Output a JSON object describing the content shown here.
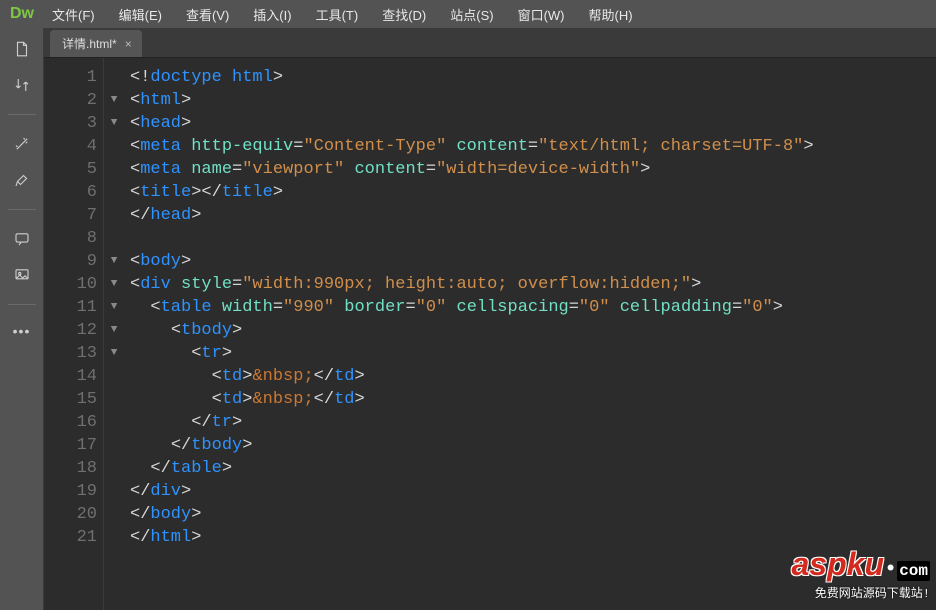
{
  "logo": "Dw",
  "menus": [
    "文件(F)",
    "编辑(E)",
    "查看(V)",
    "插入(I)",
    "工具(T)",
    "查找(D)",
    "站点(S)",
    "窗口(W)",
    "帮助(H)"
  ],
  "tab": {
    "title": "详情.html*",
    "close": "×"
  },
  "gutter_lines": 21,
  "fold_markers": {
    "2": "▼",
    "3": "▼",
    "9": "▼",
    "10": "▼",
    "11": "▼",
    "12": "▼",
    "13": "▼"
  },
  "code": [
    [
      [
        "pun",
        "<!"
      ],
      [
        "tag",
        "doctype html"
      ],
      [
        "pun",
        ">"
      ]
    ],
    [
      [
        "pun",
        "<"
      ],
      [
        "tag",
        "html"
      ],
      [
        "pun",
        ">"
      ]
    ],
    [
      [
        "pun",
        "<"
      ],
      [
        "tag",
        "head"
      ],
      [
        "pun",
        ">"
      ]
    ],
    [
      [
        "pun",
        "<"
      ],
      [
        "tag",
        "meta"
      ],
      [
        "txt",
        " "
      ],
      [
        "attr",
        "http-equiv"
      ],
      [
        "pun",
        "="
      ],
      [
        "str",
        "\"Content-Type\""
      ],
      [
        "txt",
        " "
      ],
      [
        "attr",
        "content"
      ],
      [
        "pun",
        "="
      ],
      [
        "str",
        "\"text/html; charset=UTF-8\""
      ],
      [
        "pun",
        ">"
      ]
    ],
    [
      [
        "pun",
        "<"
      ],
      [
        "tag",
        "meta"
      ],
      [
        "txt",
        " "
      ],
      [
        "attr",
        "name"
      ],
      [
        "pun",
        "="
      ],
      [
        "str",
        "\"viewport\""
      ],
      [
        "txt",
        " "
      ],
      [
        "attr",
        "content"
      ],
      [
        "pun",
        "="
      ],
      [
        "str",
        "\"width=device-width\""
      ],
      [
        "pun",
        ">"
      ]
    ],
    [
      [
        "pun",
        "<"
      ],
      [
        "tag",
        "title"
      ],
      [
        "pun",
        "></"
      ],
      [
        "tag",
        "title"
      ],
      [
        "pun",
        ">"
      ]
    ],
    [
      [
        "pun",
        "</"
      ],
      [
        "tag",
        "head"
      ],
      [
        "pun",
        ">"
      ]
    ],
    [],
    [
      [
        "pun",
        "<"
      ],
      [
        "tag",
        "body"
      ],
      [
        "pun",
        ">"
      ]
    ],
    [
      [
        "pun",
        "<"
      ],
      [
        "tag",
        "div"
      ],
      [
        "txt",
        " "
      ],
      [
        "attr",
        "style"
      ],
      [
        "pun",
        "="
      ],
      [
        "str",
        "\"width:990px; height:auto; overflow:hidden;\""
      ],
      [
        "pun",
        ">"
      ]
    ],
    [
      [
        "txt",
        "  "
      ],
      [
        "pun",
        "<"
      ],
      [
        "tag",
        "table"
      ],
      [
        "txt",
        " "
      ],
      [
        "attr",
        "width"
      ],
      [
        "pun",
        "="
      ],
      [
        "str",
        "\"990\""
      ],
      [
        "txt",
        " "
      ],
      [
        "attr",
        "border"
      ],
      [
        "pun",
        "="
      ],
      [
        "str",
        "\"0\""
      ],
      [
        "txt",
        " "
      ],
      [
        "attr",
        "cellspacing"
      ],
      [
        "pun",
        "="
      ],
      [
        "str",
        "\"0\""
      ],
      [
        "txt",
        " "
      ],
      [
        "attr",
        "cellpadding"
      ],
      [
        "pun",
        "="
      ],
      [
        "str",
        "\"0\""
      ],
      [
        "pun",
        ">"
      ]
    ],
    [
      [
        "txt",
        "    "
      ],
      [
        "pun",
        "<"
      ],
      [
        "tag",
        "tbody"
      ],
      [
        "pun",
        ">"
      ]
    ],
    [
      [
        "txt",
        "      "
      ],
      [
        "pun",
        "<"
      ],
      [
        "tag",
        "tr"
      ],
      [
        "pun",
        ">"
      ]
    ],
    [
      [
        "txt",
        "        "
      ],
      [
        "pun",
        "<"
      ],
      [
        "tag",
        "td"
      ],
      [
        "pun",
        ">"
      ],
      [
        "ent",
        "&nbsp;"
      ],
      [
        "pun",
        "</"
      ],
      [
        "tag",
        "td"
      ],
      [
        "pun",
        ">"
      ]
    ],
    [
      [
        "txt",
        "        "
      ],
      [
        "pun",
        "<"
      ],
      [
        "tag",
        "td"
      ],
      [
        "pun",
        ">"
      ],
      [
        "ent",
        "&nbsp;"
      ],
      [
        "pun",
        "</"
      ],
      [
        "tag",
        "td"
      ],
      [
        "pun",
        ">"
      ]
    ],
    [
      [
        "txt",
        "      "
      ],
      [
        "pun",
        "</"
      ],
      [
        "tag",
        "tr"
      ],
      [
        "pun",
        ">"
      ]
    ],
    [
      [
        "txt",
        "    "
      ],
      [
        "pun",
        "</"
      ],
      [
        "tag",
        "tbody"
      ],
      [
        "pun",
        ">"
      ]
    ],
    [
      [
        "txt",
        "  "
      ],
      [
        "pun",
        "</"
      ],
      [
        "tag",
        "table"
      ],
      [
        "pun",
        ">"
      ]
    ],
    [
      [
        "pun",
        "</"
      ],
      [
        "tag",
        "div"
      ],
      [
        "pun",
        ">"
      ]
    ],
    [
      [
        "pun",
        "</"
      ],
      [
        "tag",
        "body"
      ],
      [
        "pun",
        ">"
      ]
    ],
    [
      [
        "pun",
        "</"
      ],
      [
        "tag",
        "html"
      ],
      [
        "pun",
        ">"
      ]
    ]
  ],
  "watermark": {
    "main": "aspku",
    "dot": "•",
    "com": "com",
    "sub": "免费网站源码下载站!"
  }
}
